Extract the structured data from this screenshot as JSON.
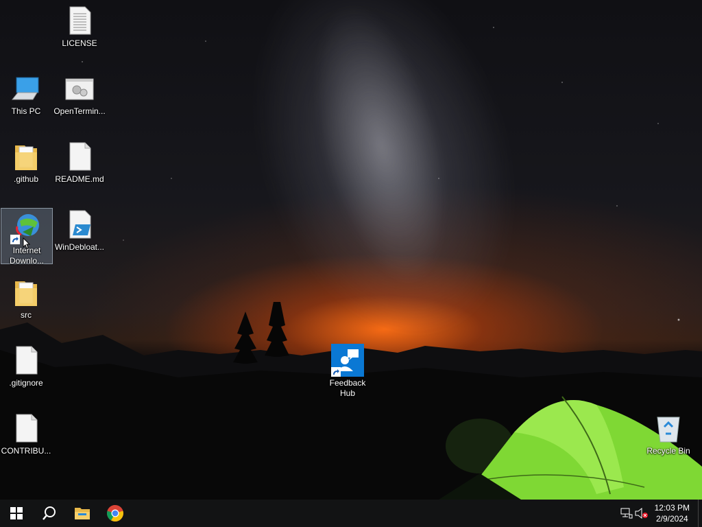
{
  "desktop": {
    "icons": [
      {
        "id": "license",
        "label": "LICENSE"
      },
      {
        "id": "this-pc",
        "label": "This PC"
      },
      {
        "id": "openterminal",
        "label": "OpenTermin..."
      },
      {
        "id": "github",
        "label": ".github"
      },
      {
        "id": "readme",
        "label": "README.md"
      },
      {
        "id": "idm",
        "label": "Internet Downlo..."
      },
      {
        "id": "windebloat",
        "label": "WinDebloat..."
      },
      {
        "id": "src",
        "label": "src"
      },
      {
        "id": "gitignore",
        "label": ".gitignore"
      },
      {
        "id": "contributing",
        "label": "CONTRIBU..."
      },
      {
        "id": "feedback-hub",
        "label": "Feedback Hub"
      },
      {
        "id": "recycle-bin",
        "label": "Recycle Bin"
      }
    ]
  },
  "taskbar": {
    "pinned": [
      {
        "name": "start",
        "icon": "windows-logo-icon"
      },
      {
        "name": "search",
        "icon": "search-icon"
      },
      {
        "name": "file-explorer",
        "icon": "folder-icon"
      },
      {
        "name": "chrome",
        "icon": "chrome-icon"
      }
    ],
    "tray": {
      "network_icon": "network-icon",
      "volume_icon": "volume-muted-icon",
      "time": "12:03 PM",
      "date": "2/9/2024"
    }
  },
  "colors": {
    "taskbar": "#121314",
    "selection": "#8ca0b4",
    "feedback_blue": "#0a78d4",
    "tent_green": "#8ee23a"
  }
}
